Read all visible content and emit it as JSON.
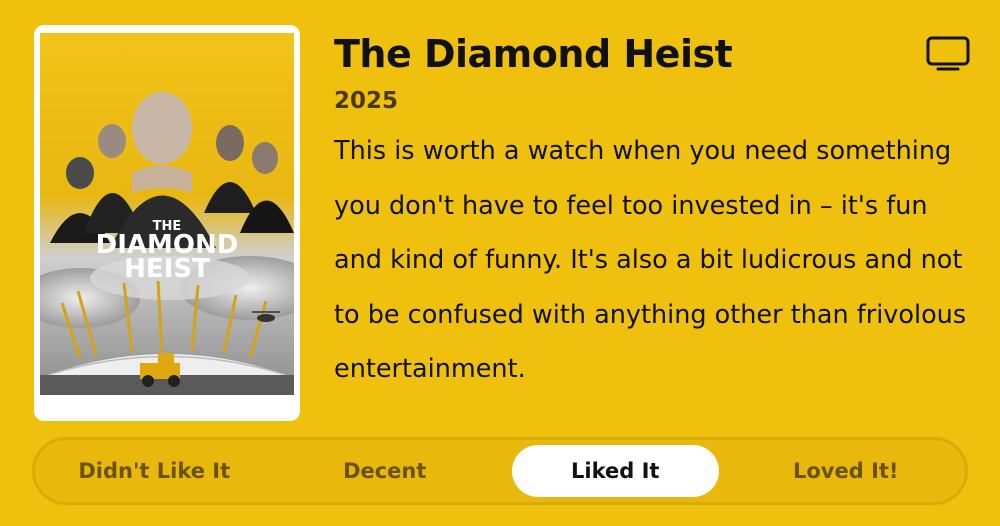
{
  "movie": {
    "title": "The Diamond Heist",
    "year": "2025",
    "description": "This is worth a watch when you need something you don't have to feel too invested in – it's fun and kind of funny. It's also a bit ludicrous and not to be confused with anything other than frivolous entertainment.",
    "poster": {
      "title_line1": "THE",
      "title_line2": "DIAMOND",
      "title_line3": "HEIST"
    }
  },
  "actions": {
    "tv_icon": "tv-icon"
  },
  "rating": {
    "options": [
      {
        "label": "Didn't Like It",
        "selected": false
      },
      {
        "label": "Decent",
        "selected": false
      },
      {
        "label": "Liked It",
        "selected": true
      },
      {
        "label": "Loved It!",
        "selected": false
      }
    ]
  },
  "colors": {
    "background": "#efc00e",
    "selected_pill": "#ffffff",
    "muted_text": "#6a5208"
  }
}
